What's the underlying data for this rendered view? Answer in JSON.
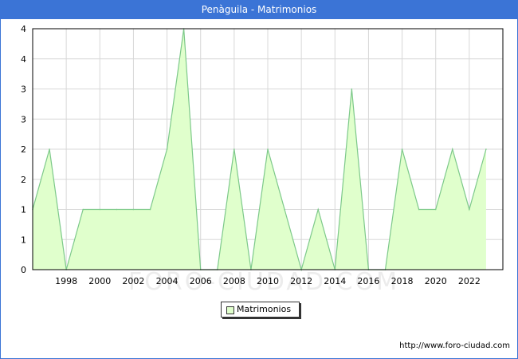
{
  "header": {
    "title": "Penàguila - Matrimonios"
  },
  "footer": {
    "source_url": "http://www.foro-ciudad.com"
  },
  "watermark": "FORO-CIUDAD.COM",
  "colors": {
    "header": "#3b74d6",
    "fill": "#e0ffcc",
    "line": "#7dc98a",
    "grid": "#d8d8d8"
  },
  "chart_data": {
    "type": "area",
    "title": "Penàguila - Matrimonios",
    "xlabel": "",
    "ylabel": "",
    "x": [
      1996,
      1997,
      1998,
      1999,
      2000,
      2001,
      2002,
      2003,
      2004,
      2005,
      2006,
      2007,
      2008,
      2009,
      2010,
      2011,
      2012,
      2013,
      2014,
      2015,
      2016,
      2017,
      2018,
      2019,
      2020,
      2021,
      2022,
      2023
    ],
    "series": [
      {
        "name": "Matrimonios",
        "values": [
          1,
          2,
          0,
          1,
          1,
          1,
          1,
          1,
          2,
          4,
          0,
          0,
          2,
          0,
          2,
          1,
          0,
          1,
          0,
          3,
          0,
          0,
          2,
          1,
          1,
          2,
          1,
          2
        ]
      }
    ],
    "xlim": [
      1996,
      2024
    ],
    "ylim": [
      0,
      4
    ],
    "x_ticks": [
      "1998",
      "2000",
      "2002",
      "2004",
      "2006",
      "2008",
      "2010",
      "2012",
      "2014",
      "2016",
      "2018",
      "2020",
      "2022"
    ],
    "y_ticks": [
      "0",
      "1",
      "1",
      "2",
      "2",
      "3",
      "3",
      "4",
      "4"
    ],
    "grid": true,
    "legend": "bottom-center"
  }
}
